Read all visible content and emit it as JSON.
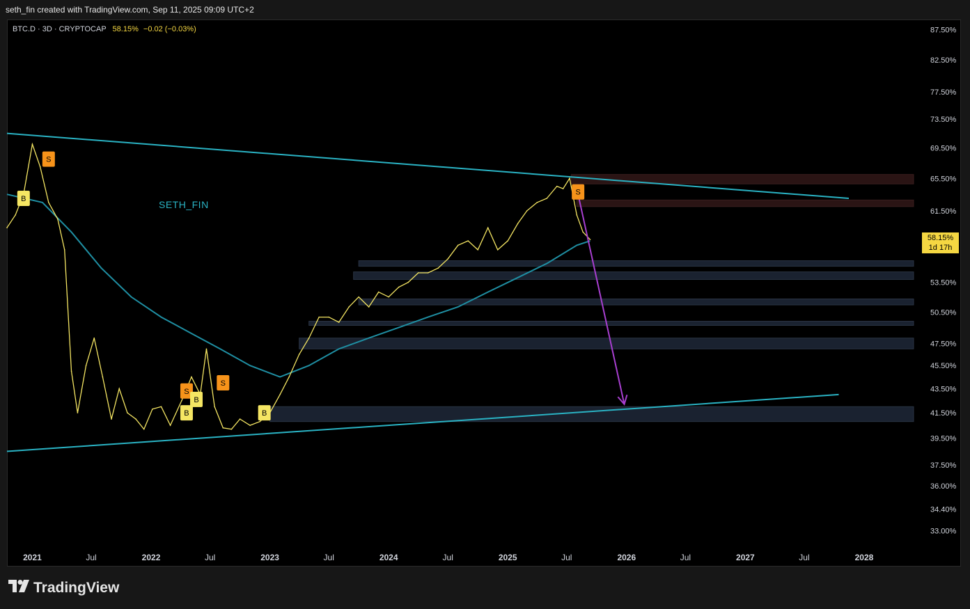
{
  "header": {
    "caption": "seth_fin created with TradingView.com, Sep 11, 2025 09:09 UTC+2"
  },
  "symbol": {
    "info": "BTC.D · 3D · CRYPTOCAP",
    "value": "58.15%",
    "change": "−0.02 (−0.03%)"
  },
  "annotation_text": "SETH_FIN",
  "price_tag": {
    "value": "58.15%",
    "countdown": "1d 17h"
  },
  "footer": {
    "brand": "TradingView"
  },
  "colors": {
    "price_line": "#f5e663",
    "ma_line": "#1f8fa3",
    "trendline": "#2ab3c4",
    "forecast_arrow": "#a83fd0",
    "buy_signal": "#f5e663",
    "sell_signal": "#f7931a",
    "zone_fill": "#1a2230"
  },
  "chart_data": {
    "type": "line",
    "scale": "log",
    "ylim": [
      32.0,
      89.0
    ],
    "xlim": [
      "2020-10-15",
      "2028-07-01"
    ],
    "y_ticks": [
      "87.50%",
      "82.50%",
      "77.50%",
      "73.50%",
      "69.50%",
      "65.50%",
      "61.50%",
      "53.50%",
      "50.50%",
      "47.50%",
      "45.50%",
      "43.50%",
      "41.50%",
      "39.50%",
      "37.50%",
      "36.00%",
      "34.40%",
      "33.00%"
    ],
    "y_tick_values": [
      87.5,
      82.5,
      77.5,
      73.5,
      69.5,
      65.5,
      61.5,
      53.5,
      50.5,
      47.5,
      45.5,
      43.5,
      41.5,
      39.5,
      37.5,
      36.0,
      34.4,
      33.0
    ],
    "x_ticks": [
      "2021",
      "Jul",
      "2022",
      "Jul",
      "2023",
      "Jul",
      "2024",
      "Jul",
      "2025",
      "Jul",
      "2026",
      "Jul",
      "2027",
      "Jul",
      "2028"
    ],
    "x_tick_dates": [
      "2021-01-01",
      "2021-07-01",
      "2022-01-01",
      "2022-07-01",
      "2023-01-01",
      "2023-07-01",
      "2024-01-01",
      "2024-07-01",
      "2025-01-01",
      "2025-07-01",
      "2026-01-01",
      "2026-07-01",
      "2027-01-01",
      "2027-07-01",
      "2028-01-01"
    ],
    "series": [
      {
        "x": [
          "2020-10-15",
          "2020-11-10",
          "2020-12-05",
          "2021-01-01",
          "2021-01-25",
          "2021-02-20",
          "2021-03-20",
          "2021-04-10",
          "2021-05-01",
          "2021-05-20",
          "2021-06-15",
          "2021-07-10",
          "2021-08-05",
          "2021-09-01",
          "2021-09-25",
          "2021-10-20",
          "2021-11-15",
          "2021-12-10",
          "2022-01-05",
          "2022-02-01",
          "2022-03-01",
          "2022-04-05",
          "2022-05-05",
          "2022-06-01",
          "2022-06-20",
          "2022-07-15",
          "2022-08-10",
          "2022-09-05",
          "2022-10-01",
          "2022-11-01",
          "2022-12-01",
          "2023-01-01",
          "2023-02-01",
          "2023-03-01",
          "2023-04-01",
          "2023-05-01",
          "2023-06-01",
          "2023-07-01",
          "2023-08-01",
          "2023-09-01",
          "2023-10-01",
          "2023-11-01",
          "2023-12-01",
          "2024-01-01",
          "2024-02-01",
          "2024-03-01",
          "2024-04-01",
          "2024-05-01",
          "2024-06-01",
          "2024-07-01",
          "2024-08-01",
          "2024-09-01",
          "2024-10-01",
          "2024-11-01",
          "2024-12-01",
          "2025-01-01",
          "2025-02-01",
          "2025-03-01",
          "2025-04-01",
          "2025-05-01",
          "2025-06-01",
          "2025-06-20",
          "2025-07-10",
          "2025-08-01",
          "2025-08-20",
          "2025-09-11"
        ],
        "values": [
          59.5,
          61.0,
          63.5,
          70.0,
          67.0,
          62.5,
          60.5,
          57.0,
          45.0,
          41.5,
          45.5,
          48.0,
          44.5,
          41.0,
          43.5,
          41.5,
          41.0,
          40.2,
          41.8,
          42.0,
          40.5,
          42.5,
          44.5,
          43.0,
          47.0,
          42.0,
          40.3,
          40.2,
          41.0,
          40.5,
          40.8,
          41.5,
          43.0,
          44.5,
          46.5,
          48.0,
          50.0,
          50.0,
          49.5,
          51.0,
          52.0,
          51.0,
          52.5,
          52.0,
          53.0,
          53.5,
          54.5,
          54.5,
          55.0,
          56.0,
          57.5,
          58.0,
          57.0,
          59.5,
          57.0,
          58.0,
          60.0,
          61.5,
          62.5,
          63.0,
          64.5,
          64.2,
          65.5,
          61.0,
          59.0,
          58.15
        ]
      },
      {
        "x": [
          "2020-10-15",
          "2021-02-01",
          "2021-05-01",
          "2021-08-01",
          "2021-11-01",
          "2022-02-01",
          "2022-05-01",
          "2022-08-01",
          "2022-11-01",
          "2023-02-01",
          "2023-05-01",
          "2023-08-01",
          "2023-11-01",
          "2024-02-01",
          "2024-05-01",
          "2024-08-01",
          "2024-11-01",
          "2025-02-01",
          "2025-05-01",
          "2025-08-01",
          "2025-09-11"
        ],
        "values": [
          63.5,
          62.5,
          59.0,
          55.0,
          52.0,
          50.0,
          48.5,
          47.0,
          45.5,
          44.5,
          45.5,
          47.0,
          48.0,
          49.0,
          50.0,
          51.0,
          52.5,
          54.0,
          55.5,
          57.5,
          58.0
        ]
      }
    ],
    "trendlines": [
      {
        "x": [
          "2020-10-15",
          "2027-11-15"
        ],
        "y": [
          71.5,
          63.0
        ]
      },
      {
        "x": [
          "2020-10-15",
          "2027-10-15"
        ],
        "y": [
          38.5,
          43.0
        ]
      }
    ],
    "forecast_arrow": {
      "x": [
        "2025-08-05",
        "2025-12-25"
      ],
      "y": [
        63.5,
        42.2
      ]
    },
    "zones": [
      {
        "x": [
          "2025-07-15",
          "2028-06-01"
        ],
        "y": [
          64.8,
          66.0
        ]
      },
      {
        "x": [
          "2025-08-01",
          "2028-06-01"
        ],
        "y": [
          62.0,
          62.8
        ]
      },
      {
        "x": [
          "2023-10-01",
          "2028-06-01"
        ],
        "y": [
          55.2,
          55.8
        ]
      },
      {
        "x": [
          "2023-09-15",
          "2028-06-01"
        ],
        "y": [
          53.8,
          54.6
        ]
      },
      {
        "x": [
          "2023-10-01",
          "2028-06-01"
        ],
        "y": [
          51.2,
          51.8
        ]
      },
      {
        "x": [
          "2023-05-01",
          "2028-06-01"
        ],
        "y": [
          49.2,
          49.6
        ]
      },
      {
        "x": [
          "2023-04-01",
          "2028-06-01"
        ],
        "y": [
          47.0,
          48.0
        ]
      },
      {
        "x": [
          "2023-01-01",
          "2028-06-01"
        ],
        "y": [
          40.8,
          42.0
        ]
      }
    ],
    "signals": [
      {
        "label": "B",
        "type": "buy",
        "x": "2020-12-05",
        "y": 63.0
      },
      {
        "label": "S",
        "type": "sell",
        "x": "2021-02-20",
        "y": 68.0
      },
      {
        "label": "S",
        "type": "sell",
        "x": "2022-04-20",
        "y": 43.3
      },
      {
        "label": "B",
        "type": "buy",
        "x": "2022-04-20",
        "y": 41.5
      },
      {
        "label": "B",
        "type": "buy",
        "x": "2022-05-20",
        "y": 42.6
      },
      {
        "label": "S",
        "type": "sell",
        "x": "2022-08-10",
        "y": 44.0
      },
      {
        "label": "B",
        "type": "buy",
        "x": "2022-12-15",
        "y": 41.5
      },
      {
        "label": "S",
        "type": "sell",
        "x": "2025-08-05",
        "y": 63.8
      }
    ],
    "title": "",
    "xlabel": "",
    "ylabel": ""
  }
}
